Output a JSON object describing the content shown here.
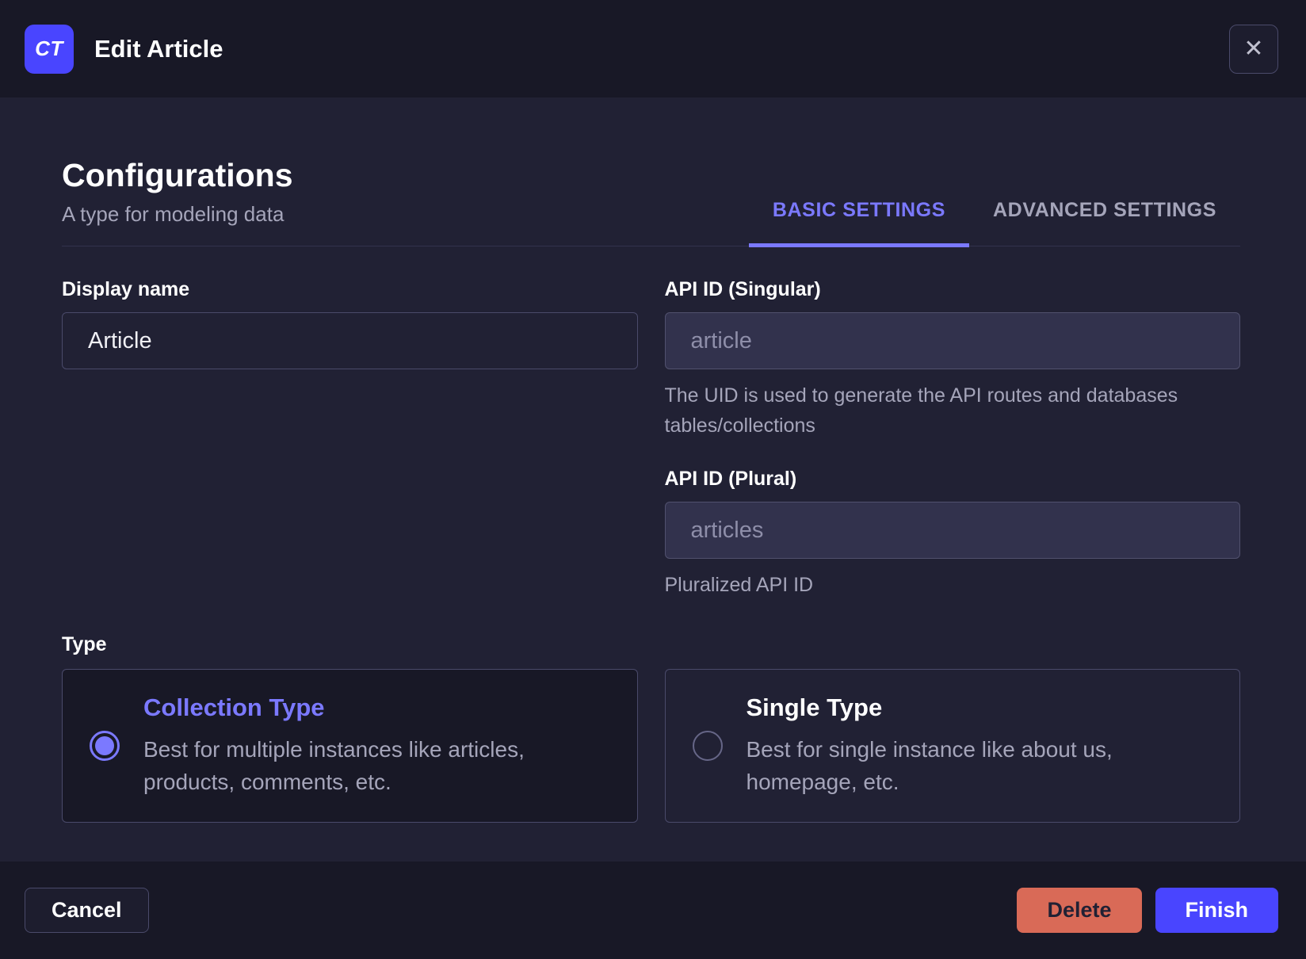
{
  "header": {
    "badge": "CT",
    "title": "Edit Article",
    "close_icon": "✕"
  },
  "section": {
    "title": "Configurations",
    "subtitle": "A type for modeling data",
    "tabs": [
      {
        "label": "BASIC SETTINGS",
        "active": true
      },
      {
        "label": "ADVANCED SETTINGS",
        "active": false
      }
    ]
  },
  "form": {
    "display_name": {
      "label": "Display name",
      "value": "Article"
    },
    "api_id_singular": {
      "label": "API ID (Singular)",
      "value": "article",
      "hint": "The UID is used to generate the API routes and databases tables/collections"
    },
    "api_id_plural": {
      "label": "API ID (Plural)",
      "value": "articles",
      "hint": "Pluralized API ID"
    },
    "type": {
      "label": "Type",
      "options": [
        {
          "title": "Collection Type",
          "description": "Best for multiple instances like articles, products, comments, etc.",
          "selected": true
        },
        {
          "title": "Single Type",
          "description": "Best for single instance like about us, homepage, etc.",
          "selected": false
        }
      ]
    }
  },
  "footer": {
    "cancel_label": "Cancel",
    "delete_label": "Delete",
    "finish_label": "Finish"
  },
  "colors": {
    "accent": "#4945ff",
    "accent_light": "#7b79ff",
    "danger": "#d96a57",
    "header_bg": "#181826",
    "body_bg": "#212134",
    "border": "#4a4a6a",
    "muted_text": "#a5a5ba",
    "placeholder_text": "#8e8ea9"
  }
}
